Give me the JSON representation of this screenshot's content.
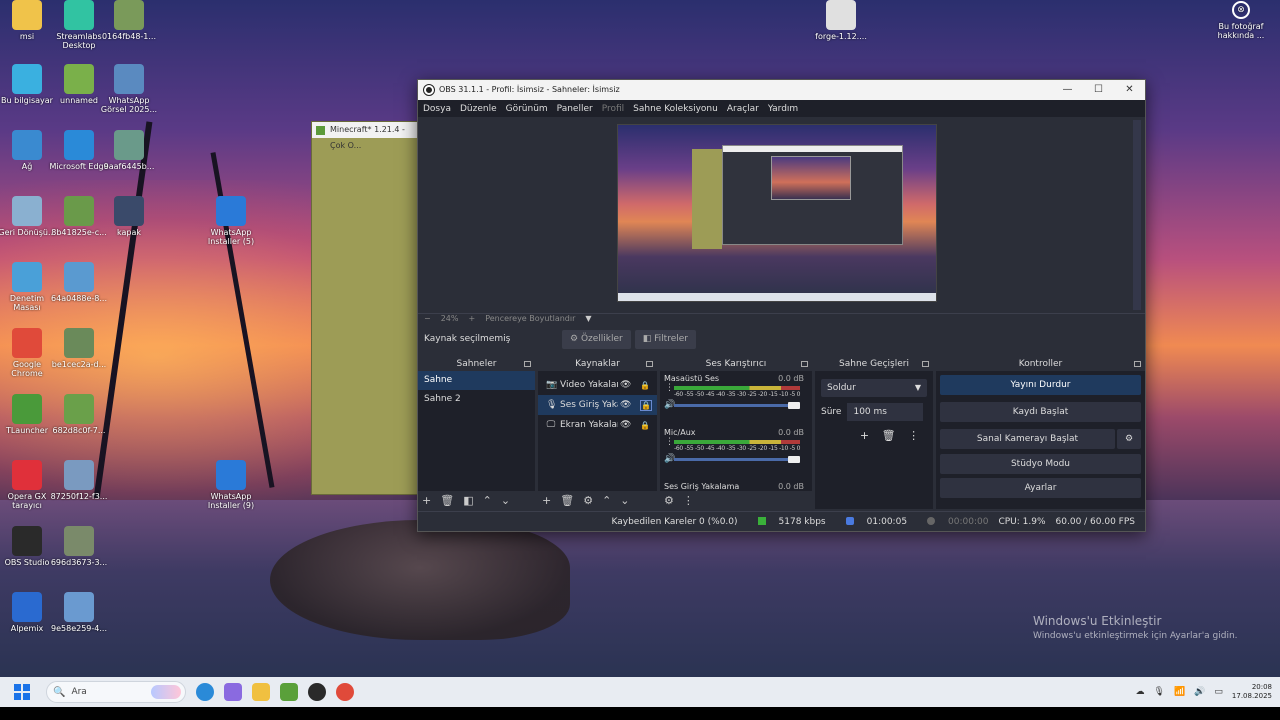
{
  "desktop": {
    "icons": [
      {
        "label": "msi",
        "color": "#f0c34a"
      },
      {
        "label": "Streamlabs Desktop",
        "color": "#31c3a2"
      },
      {
        "label": "0164fb48-1...",
        "color": "#7a9a5a"
      },
      {
        "label": "Bu bilgisayar",
        "color": "#3ab0e0"
      },
      {
        "label": "unnamed",
        "color": "#7ab04a"
      },
      {
        "label": "WhatsApp Görsel 2025...",
        "color": "#5a8ac0"
      },
      {
        "label": "Ağ",
        "color": "#3a8ad0"
      },
      {
        "label": "Microsoft Edge",
        "color": "#2a8ad8"
      },
      {
        "label": "9aaf6445b...",
        "color": "#6a9a8a"
      },
      {
        "label": "Geri Dönüşü...",
        "color": "#8ab0d0"
      },
      {
        "label": "8b41825e-c...",
        "color": "#6a9a4a"
      },
      {
        "label": "kapak",
        "color": "#3a4a6a"
      },
      {
        "label": "WhatsApp Installer (5)",
        "color": "#2a7ad8"
      },
      {
        "label": "Denetim Masası",
        "color": "#4aa0d8"
      },
      {
        "label": "64a0488e-8...",
        "color": "#5a9ad0"
      },
      {
        "label": "Google Chrome",
        "color": "#e04a3a"
      },
      {
        "label": "be1cec2a-d...",
        "color": "#6a8a5a"
      },
      {
        "label": "TLauncher",
        "color": "#4a9a3a"
      },
      {
        "label": "682d8c0f-7...",
        "color": "#6aa04a"
      },
      {
        "label": "Opera GX tarayıcı",
        "color": "#e0303a"
      },
      {
        "label": "87250f12-f3...",
        "color": "#7a9ac0"
      },
      {
        "label": "WhatsApp Installer (9)",
        "color": "#2a7ad8"
      },
      {
        "label": "OBS Studio",
        "color": "#2a2a2a"
      },
      {
        "label": "696d3673-3...",
        "color": "#7a8a6a"
      },
      {
        "label": "Alpemix",
        "color": "#2a6ad0"
      },
      {
        "label": "9e58e259-4...",
        "color": "#6a9ad0"
      },
      {
        "label": "forge-1.12....",
        "color": "#e0e0e0"
      }
    ],
    "photo_info": "Bu fotoğraf hakkında ...",
    "activation_title": "Windows'u Etkinleştir",
    "activation_text": "Windows'u etkinleştirmek için Ayarlar'a gidin."
  },
  "minecraft": {
    "title": "Minecraft* 1.21.4 - Çok O..."
  },
  "obs": {
    "title": "OBS 31.1.1 - Profil: İsimsiz - Sahneler: İsimsiz",
    "menu": [
      "Dosya",
      "Düzenle",
      "Görünüm",
      "Paneller",
      "Profil",
      "Sahne Koleksiyonu",
      "Araçlar",
      "Yardım"
    ],
    "zoom": {
      "minus": "−",
      "value": "24%",
      "plus": "+",
      "fit": "Pencereye Boyutlandır"
    },
    "source_bar": {
      "label": "Kaynak seçilmemiş",
      "properties": "Özellikler",
      "filters": "Filtreler"
    },
    "docks": {
      "scenes": {
        "title": "Sahneler",
        "items": [
          "Sahne",
          "Sahne 2"
        ]
      },
      "sources": {
        "title": "Kaynaklar",
        "items": [
          "Video Yakalam",
          "Ses Giriş Yakal",
          "Ekran Yakalam"
        ]
      },
      "mixer": {
        "title": "Ses Karıştırıcı",
        "scale": "-60 -55 -50 -45 -40 -35 -30 -25 -20 -15 -10 -5 0",
        "channels": [
          {
            "name": "Masaüstü Ses",
            "db": "0.0 dB"
          },
          {
            "name": "Mic/Aux",
            "db": "0.0 dB"
          },
          {
            "name": "Ses Giriş Yakalama",
            "db": "0.0 dB"
          }
        ]
      },
      "transitions": {
        "title": "Sahne Geçişleri",
        "selected": "Soldur",
        "duration_label": "Süre",
        "duration": "100 ms"
      },
      "controls": {
        "title": "Kontroller",
        "buttons": [
          "Yayını Durdur",
          "Kaydı Başlat",
          "Sanal Kamerayı Başlat",
          "Stüdyo Modu",
          "Ayarlar"
        ]
      }
    },
    "status": {
      "dropped": "Kaybedilen Kareler 0 (%0.0)",
      "bitrate": "5178 kbps",
      "stream_time": "01:00:05",
      "rec_time": "00:00:00",
      "cpu": "CPU: 1.9%",
      "fps": "60.00 / 60.00 FPS"
    }
  },
  "taskbar": {
    "search_placeholder": "Ara",
    "apps": [
      {
        "name": "edge",
        "color": "#2a8ad8"
      },
      {
        "name": "copilot",
        "color": "#8a6ae0"
      },
      {
        "name": "explorer",
        "color": "#f0c040"
      },
      {
        "name": "minecraft",
        "color": "#5aa03a"
      },
      {
        "name": "obs",
        "color": "#2a2a2a"
      },
      {
        "name": "chrome",
        "color": "#e04a3a"
      }
    ],
    "time": "20:08",
    "date": "17.08.2025"
  }
}
